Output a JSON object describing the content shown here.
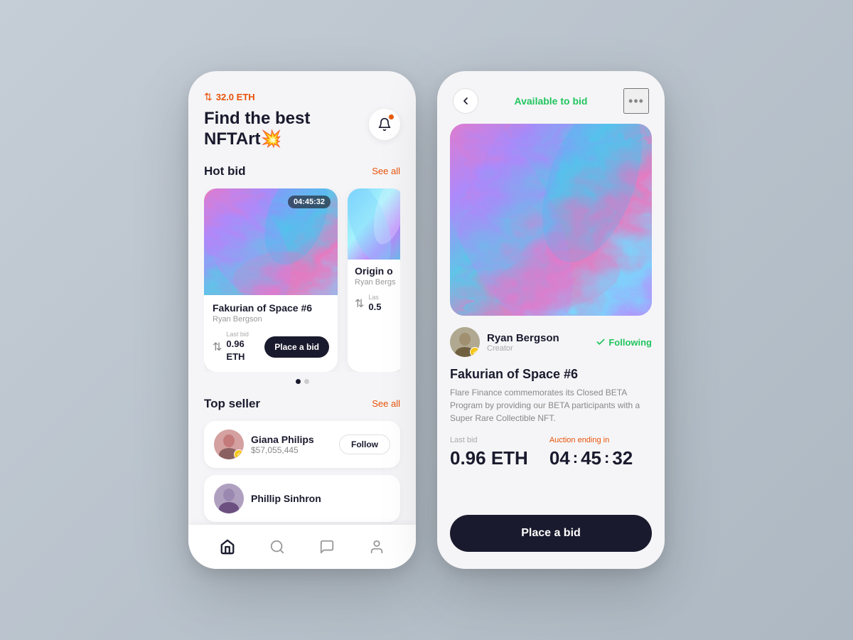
{
  "left_phone": {
    "eth_badge": "32.0 ETH",
    "title_line1": "Find the best",
    "title_line2": "NFTArt💥",
    "hot_bid": "Hot bid",
    "see_all_1": "See all",
    "card1": {
      "name": "Fakurian of Space #6",
      "creator": "Ryan Bergson",
      "timer": "04:45:32",
      "last_bid_label": "Last bid",
      "bid_value": "0.96 ETH",
      "place_bid": "Place a bid"
    },
    "card2": {
      "name": "Origin o",
      "creator": "Ryan Bergs",
      "last_bid_label": "Las",
      "bid_value": "0.5"
    },
    "top_seller": "Top seller",
    "see_all_2": "See all",
    "seller1": {
      "name": "Giana Philips",
      "amount": "$57,055,445",
      "follow_label": "Follow"
    },
    "seller2": {
      "name": "Phillip Sinhron"
    },
    "nav": {
      "home": "🏠",
      "search": "💬",
      "chat": "💭",
      "profile": "👤"
    }
  },
  "right_phone": {
    "back_label": "←",
    "available_label": "Available to bid",
    "more_label": "•••",
    "creator_name": "Ryan Bergson",
    "creator_role": "Creator",
    "following_label": "Following",
    "nft_name": "Fakurian of Space #6",
    "nft_desc": "Flare Finance commemorates its Closed BETA Program by providing our BETA participants with a Super Rare Collectible NFT.",
    "last_bid_label": "Last bid",
    "last_bid_value": "0.96 ETH",
    "auction_label": "Auction ending in",
    "timer_h": "04",
    "timer_m": "45",
    "timer_s": "32",
    "place_bid_label": "Place a bid"
  },
  "colors": {
    "orange": "#e8520a",
    "green": "#22c55e",
    "dark": "#1a1a2e",
    "yellow": "#f5c518"
  }
}
